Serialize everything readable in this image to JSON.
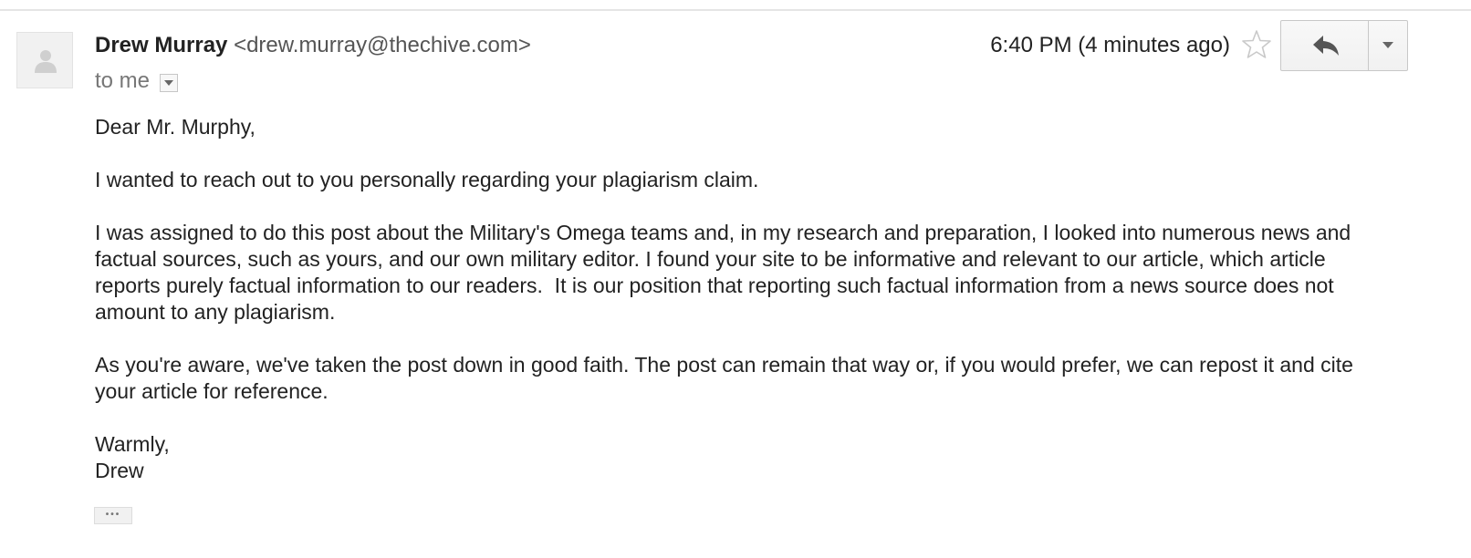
{
  "message": {
    "sender_name": "Drew Murray",
    "sender_email": "<drew.murray@thechive.com>",
    "recipient_label": "to me",
    "timestamp": "6:40 PM (4 minutes ago)",
    "body": {
      "greeting": "Dear Mr. Murphy,",
      "paragraph_1": "I wanted to reach out to you personally regarding your plagiarism claim.",
      "paragraph_2": "I was assigned to do this post about the Military's Omega teams and, in my research and preparation, I looked into numerous news and factual sources, such as yours, and our own military editor. I found your site to be informative and relevant to our article, which article reports purely factual information to our readers.  It is our position that reporting such factual information from a news source does not amount to any plagiarism.",
      "paragraph_3": "As you're aware, we've taken the post down in good faith. The post can remain that way or, if you would prefer, we can repost it and cite your article for reference.",
      "closing": "Warmly,",
      "signature": "Drew"
    },
    "trimmed_content_label": "•••"
  },
  "icons": {
    "avatar": "person-icon",
    "details_toggle": "chevron-down-icon",
    "star": "star-outline-icon",
    "reply": "reply-arrow-icon",
    "more": "caret-down-icon"
  },
  "colors": {
    "text": "#222222",
    "muted_text": "#777777",
    "email_text": "#555555",
    "border": "#c8c8c8"
  }
}
